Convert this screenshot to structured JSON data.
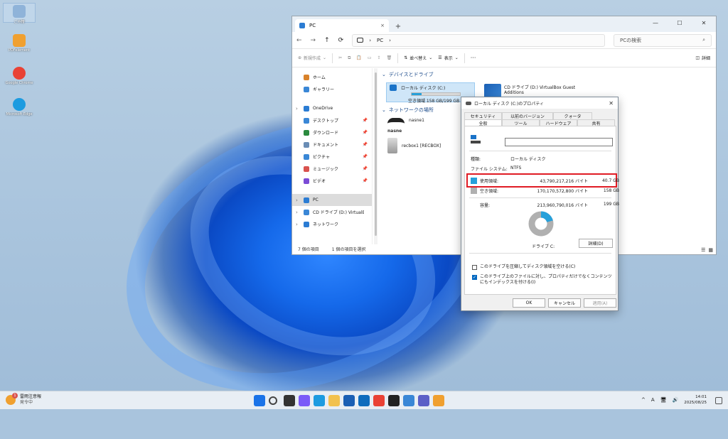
{
  "desktop": {
    "icons": [
      {
        "label": "ごみ箱",
        "color": "#8fb3d9"
      },
      {
        "label": "PDFelement",
        "color": "#f0a030"
      },
      {
        "label": "Google Chrome",
        "color": "#e94235"
      },
      {
        "label": "Microsoft Edge",
        "color": "#1c9be0"
      }
    ]
  },
  "explorer": {
    "tab_title": "PC",
    "tab_close": "×",
    "new_tab": "+",
    "window_controls": [
      "—",
      "☐",
      "✕"
    ],
    "address": {
      "back": "←",
      "forward": "→",
      "up": "↑",
      "refresh": "⟳",
      "monitor": "🖥",
      "sep": "›",
      "path": "PC",
      "sep2": "›"
    },
    "search_placeholder": "PCの検索",
    "search_glyph": "⌕",
    "toolbar": {
      "new": "新規作成",
      "sort": "並べ替え",
      "view": "表示",
      "more": "···",
      "details": "詳細"
    },
    "nav": [
      {
        "label": "ホーム",
        "icon": "home-icon",
        "color": "#d9822b",
        "chev": "",
        "pin": ""
      },
      {
        "label": "ギャラリー",
        "icon": "gallery-icon",
        "color": "#3a87d6",
        "chev": "",
        "pin": ""
      },
      {
        "label": "OneDrive",
        "icon": "cloud-icon",
        "color": "#2b7cd3",
        "chev": "›",
        "pin": ""
      },
      {
        "label": "デスクトップ",
        "icon": "desktop-icon",
        "color": "#3a87d6",
        "chev": "",
        "pin": "📌"
      },
      {
        "label": "ダウンロード",
        "icon": "download-icon",
        "color": "#2b8a3e",
        "chev": "",
        "pin": "📌"
      },
      {
        "label": "ドキュメント",
        "icon": "document-icon",
        "color": "#6a8db5",
        "chev": "",
        "pin": "📌"
      },
      {
        "label": "ピクチャ",
        "icon": "pictures-icon",
        "color": "#3a87d6",
        "chev": "",
        "pin": "📌"
      },
      {
        "label": "ミュージック",
        "icon": "music-icon",
        "color": "#d9534f",
        "chev": "",
        "pin": "📌"
      },
      {
        "label": "ビデオ",
        "icon": "video-icon",
        "color": "#7b4bd6",
        "chev": "",
        "pin": "📌"
      },
      {
        "label": "PC",
        "icon": "pc-icon",
        "color": "#2b7cd3",
        "chev": "›",
        "pin": ""
      },
      {
        "label": "CD ドライブ (D:) VirtualBox Guest",
        "icon": "cd-icon",
        "color": "#3a87d6",
        "chev": "›",
        "pin": ""
      },
      {
        "label": "ネットワーク",
        "icon": "network-icon",
        "color": "#2b7cd3",
        "chev": "›",
        "pin": ""
      }
    ],
    "sections": {
      "devices": "デバイスとドライブ",
      "network": "ネットワークの場所"
    },
    "drive_c": {
      "name": "ローカル ディスク (C:)",
      "free": "空き領域 158 GB/199 GB",
      "used_fraction": 0.2
    },
    "drive_d": {
      "name": "CD ドライブ (D:) VirtualBox Guest",
      "name2": "Additions"
    },
    "net_items": [
      "nasne1",
      "recbox1 [RECBOX]"
    ],
    "nasne_logo": "nasne",
    "status": {
      "count": "7 個の項目",
      "selected": "1 個の項目を選択"
    }
  },
  "dialog": {
    "title": "ローカル ディスク (C:)のプロパティ",
    "close": "✕",
    "tabs_row1": [
      "セキュリティ",
      "以前のバージョン",
      "クォータ"
    ],
    "tabs_row2": [
      "全般",
      "ツール",
      "ハードウェア",
      "共有"
    ],
    "type_label": "種類:",
    "type_value": "ローカル ディスク",
    "fs_label": "ファイル システム:",
    "fs_value": "NTFS",
    "used_label": "使用領域:",
    "used_bytes": "43,790,217,216 バイト",
    "used_gb": "40.7 GB",
    "used_color": "#26a0da",
    "free_label": "空き領域:",
    "free_bytes": "170,170,572,800 バイト",
    "free_gb": "158 GB",
    "free_color": "#b0b0b0",
    "cap_label": "容量:",
    "cap_bytes": "213,960,790,016 バイト",
    "cap_gb": "199 GB",
    "drive_label": "ドライブ C:",
    "details_btn": "詳細(D)",
    "used_fraction": 0.205,
    "compress": "このドライブを圧縮してディスク領域を空ける(C)",
    "compress_checked": false,
    "index": "このドライブ上のファイルに対し、プロパティだけでなくコンテンツにもインデックスを付ける(I)",
    "index_checked": true,
    "check_mark": "✓",
    "ok": "OK",
    "cancel": "キャンセル",
    "apply": "適用(A)"
  },
  "taskbar": {
    "weather_title": "雷雨注意報",
    "weather_sub": "発令中",
    "weather_badge": "1",
    "apps": [
      {
        "name": "start",
        "color": "#1a73e8"
      },
      {
        "name": "search",
        "color": "#444"
      },
      {
        "name": "task-view",
        "color": "#333"
      },
      {
        "name": "copilot",
        "color": "#7a5af8"
      },
      {
        "name": "edge",
        "color": "#1c9be0"
      },
      {
        "name": "explorer",
        "color": "#f2c14e"
      },
      {
        "name": "store",
        "color": "#1a5fb4"
      },
      {
        "name": "outlook",
        "color": "#0f6cbd"
      },
      {
        "name": "chrome",
        "color": "#e94235"
      },
      {
        "name": "terminal",
        "color": "#222"
      },
      {
        "name": "remote",
        "color": "#3a87d6"
      },
      {
        "name": "teams",
        "color": "#5b5fc7"
      },
      {
        "name": "pdf",
        "color": "#f0a030"
      }
    ],
    "tray": {
      "up": "^",
      "ime": "A",
      "time": "14:01",
      "date": "2025/08/25"
    }
  }
}
